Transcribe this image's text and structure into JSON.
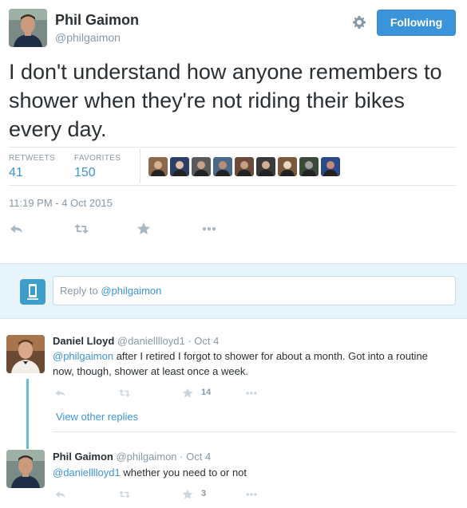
{
  "tweet": {
    "author_name": "Phil Gaimon",
    "author_handle": "@philgaimon",
    "follow_label": "Following",
    "text": "I don't understand how anyone remembers to shower when they're not riding their bikes every day.",
    "retweets_label": "RETWEETS",
    "retweets_count": "41",
    "favorites_label": "FAVORITES",
    "favorites_count": "150",
    "timestamp": "11:19 PM - 4 Oct 2015",
    "favoriters_shown": 9
  },
  "reply_box": {
    "prefix": "Reply to ",
    "handle": "@philgaimon"
  },
  "replies": [
    {
      "name": "Daniel Lloyd",
      "handle": "@danielllloyd1",
      "date": "Oct 4",
      "mention": "@philgaimon",
      "text": " after I retired I forgot to shower for about a month. Got into a routine now, though, shower at least once a week.",
      "favorites": "14"
    },
    {
      "name": "Phil Gaimon",
      "handle": "@philgaimon",
      "date": "Oct 4",
      "mention": "@danielllloyd1",
      "text": " whether you need to or not",
      "favorites": "3"
    }
  ],
  "view_other_replies": "View other replies",
  "icons": [
    "gear-icon",
    "reply-icon",
    "retweet-icon",
    "favorite-icon",
    "more-icon",
    "twitter-app-logo"
  ],
  "colors": {
    "link": "#3b94d9",
    "follow_button": "#3b94d9",
    "muted": "#8899a6",
    "reply_bar": "#e8f4fb",
    "thread_line": "#6bbdd6"
  }
}
